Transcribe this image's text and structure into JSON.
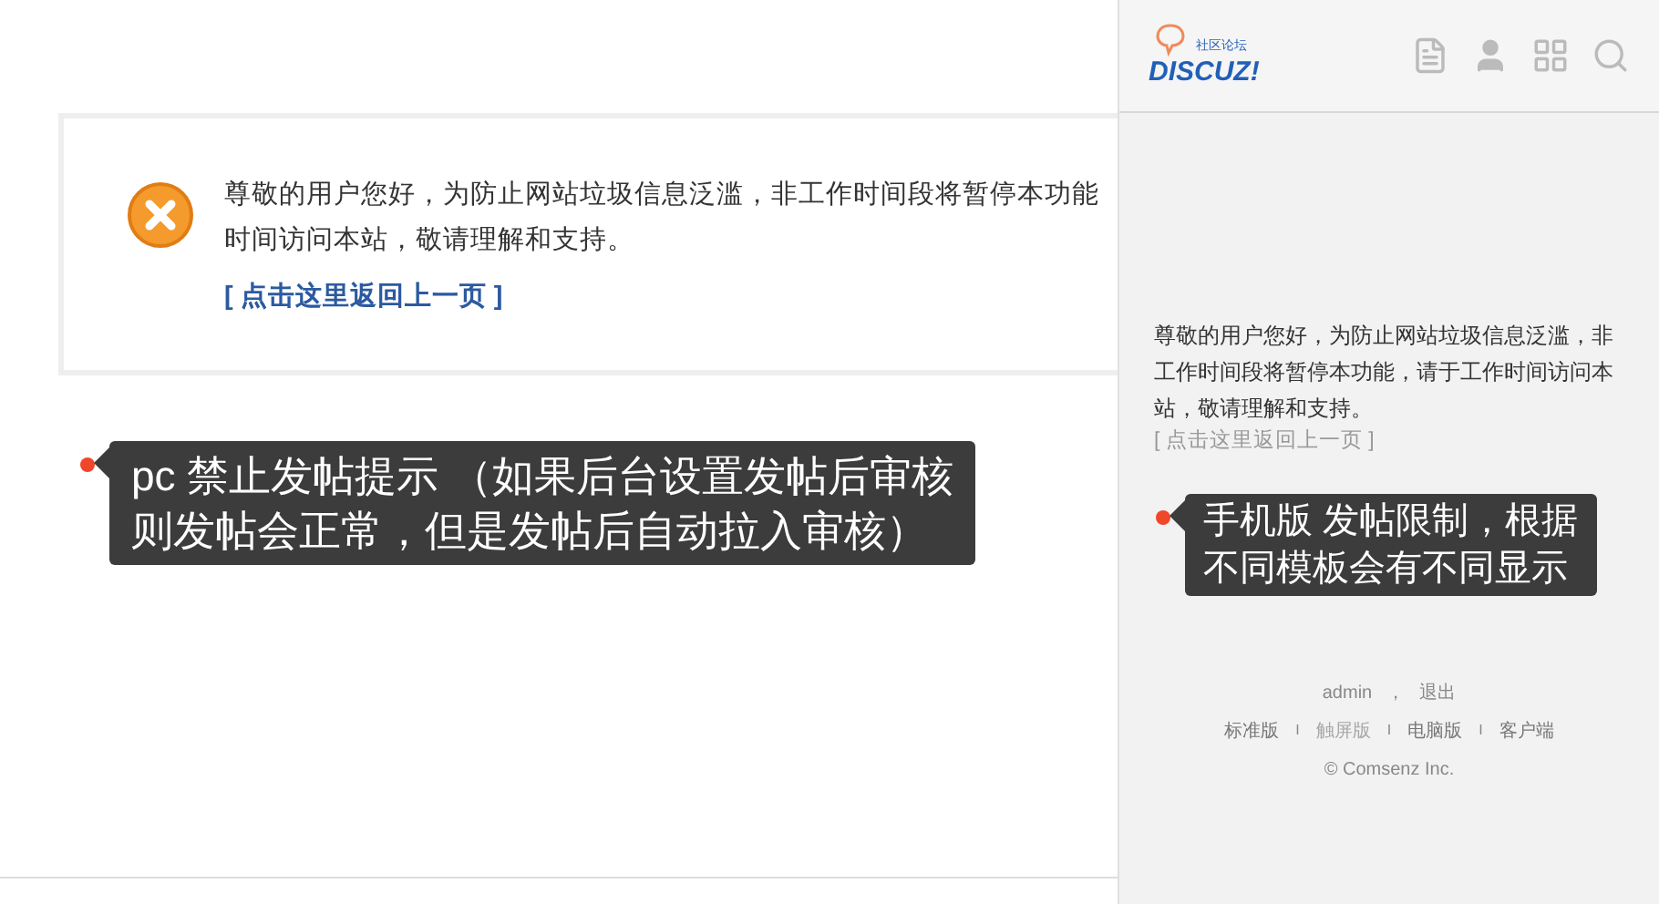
{
  "pc_message": {
    "lines": [
      "尊敬的用户您好，为防止网站垃圾信息泛滥，非工作时间段将暂停本功能",
      "时间访问本站，敬请理解和支持。"
    ],
    "back_link": "[ 点击这里返回上一页 ]"
  },
  "pc_callout": {
    "lines": [
      "pc 禁止发帖提示 （如果后台设置发帖后审核",
      "则发帖会正常，但是发帖后自动拉入审核）"
    ]
  },
  "mobile": {
    "logo": {
      "tagline": "社区论坛",
      "wordmark": "DISCUZ!"
    },
    "message": "尊敬的用户您好，为防止网站垃圾信息泛滥，非工作时间段将暂停本功能，请于工作时间访问本站，敬请理解和支持。",
    "back_link": "[ 点击这里返回上一页 ]",
    "callout": {
      "lines": [
        "手机版 发帖限制，根据",
        "不同模板会有不同显示"
      ]
    },
    "user": "admin",
    "separator": "，",
    "logout": "退出",
    "versions": [
      {
        "label": "标准版",
        "selected": false
      },
      {
        "divider": "I",
        "label": "触屏版",
        "selected": true
      },
      {
        "divider": "I",
        "label": "电脑版",
        "selected": false
      },
      {
        "divider": "I",
        "label": "客户端",
        "selected": false
      }
    ],
    "copyright": "© Comsenz Inc."
  }
}
